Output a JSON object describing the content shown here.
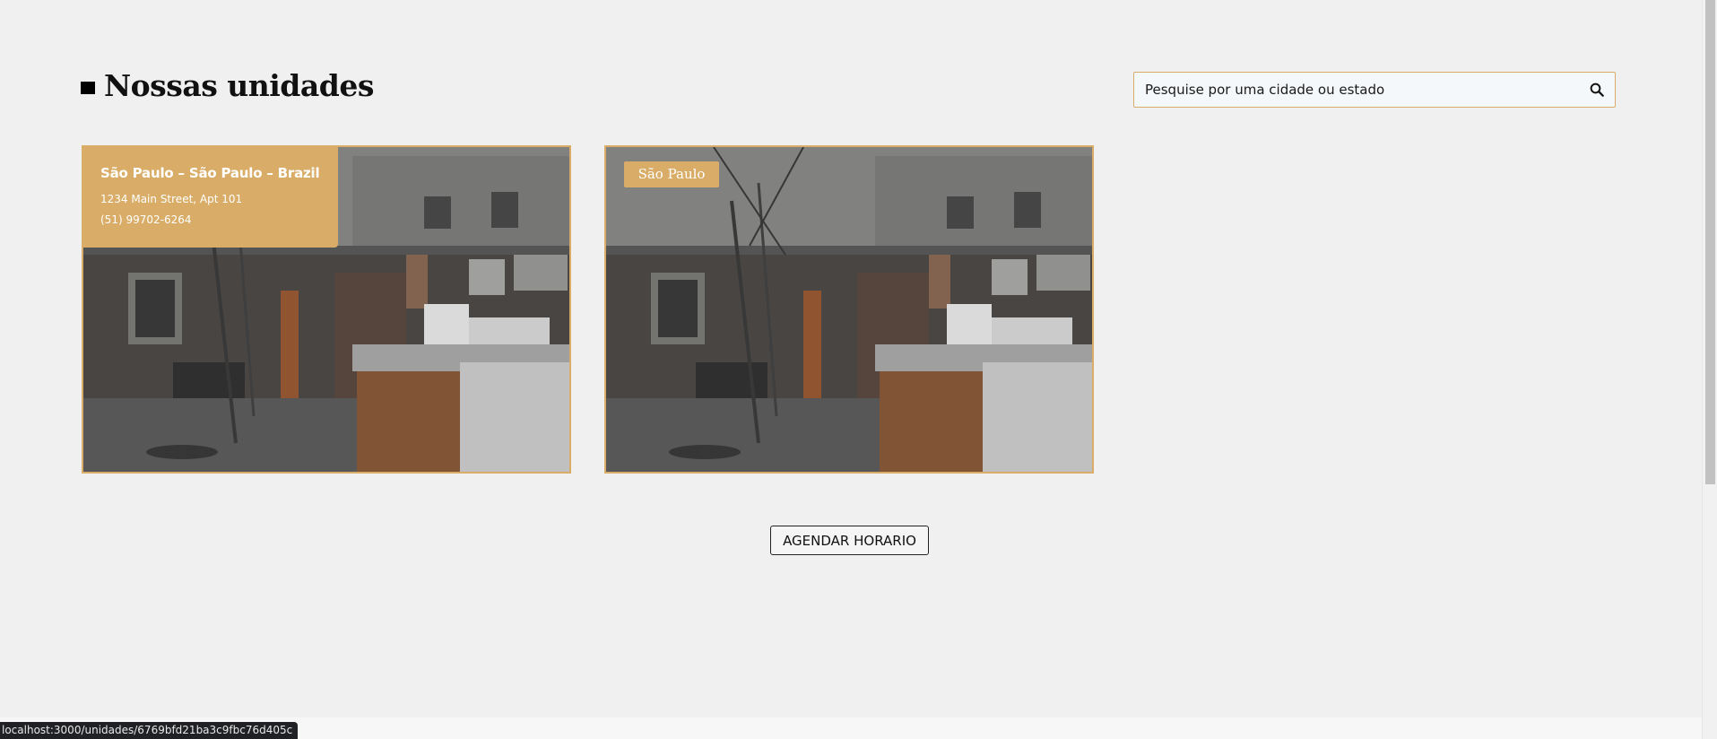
{
  "header": {
    "title": "Nossas unidades"
  },
  "search": {
    "placeholder": "Pesquise por uma cidade ou estado"
  },
  "icons": {
    "search": "search-icon",
    "title_marker": "square-icon"
  },
  "units": [
    {
      "name": "São Paulo – São Paulo – Brazil",
      "address": "1234 Main Street, Apt 101",
      "phone": "(51) 99702-6264"
    },
    {
      "city_tag": "São Paulo"
    }
  ],
  "actions": {
    "schedule_label": "AGENDAR HORARIO"
  },
  "status_bar": {
    "url": "localhost:3000/unidades/6769bfd21ba3c9fbc76d405c"
  },
  "colors": {
    "accent": "#d9ad67",
    "background": "#f0f0f0",
    "text": "#111111"
  }
}
